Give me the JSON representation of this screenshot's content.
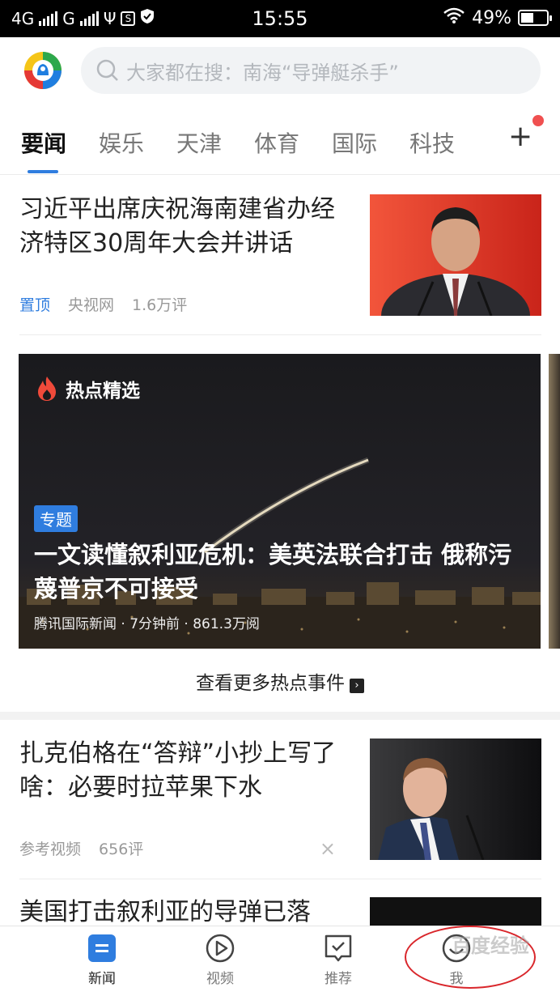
{
  "status_bar": {
    "network_1": "4G",
    "network_2": "G",
    "time": "15:55",
    "battery": "49%",
    "battery_level": 0.49
  },
  "header": {
    "search_placeholder": "大家都在搜：南海“导弹艇杀手”"
  },
  "tabs": [
    "要闻",
    "娱乐",
    "天津",
    "体育",
    "国际",
    "科技"
  ],
  "active_tab": 0,
  "tab_add": "+",
  "articles": [
    {
      "title": "习近平出席庆祝海南建省办经济特区30周年大会并讲话",
      "pin": "置顶",
      "source": "央视网",
      "comments": "1.6万评"
    },
    {
      "title": "扎克伯格在“答辩”小抄上写了啥：必要时拉苹果下水",
      "source": "参考视频",
      "comments": "656评",
      "dismiss": "×"
    },
    {
      "title": "美国打击叙利亚的导弹已落"
    }
  ],
  "hot_card": {
    "label": "热点精选",
    "tag": "专题",
    "title": "一文读懂叙利亚危机：美英法联合打击 俄称污蔑普京不可接受",
    "meta": "腾讯国际新闻 · 7分钟前 · 861.3万阅"
  },
  "more_link": "查看更多热点事件",
  "bottom_nav": [
    {
      "label": "新闻",
      "icon": "news-icon"
    },
    {
      "label": "视频",
      "icon": "video-play-icon"
    },
    {
      "label": "推荐",
      "icon": "recommend-icon"
    },
    {
      "label": "我",
      "icon": "profile-smile-icon"
    }
  ],
  "watermark": "百度经验",
  "colors": {
    "accent": "#2f7ddf",
    "badge_dot": "#f05050",
    "annotation": "#d9262b"
  }
}
